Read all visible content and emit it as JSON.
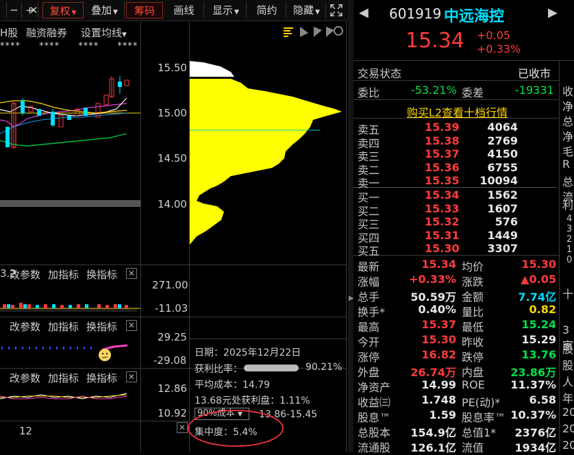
{
  "toolbar": {
    "items": [
      {
        "label": "─"
      },
      {
        "label": "+"
      },
      {
        "label": "✕"
      },
      {
        "label": "复权",
        "dropdown": true,
        "active": true
      },
      {
        "label": "叠加",
        "dropdown": true
      },
      {
        "label": "筹码",
        "active": true
      },
      {
        "label": "画线"
      },
      {
        "label": "显示",
        "dropdown": true
      },
      {
        "label": "简约"
      },
      {
        "label": "隐藏",
        "dropdown": true
      }
    ]
  },
  "subbar": {
    "items": [
      "H股",
      "融资融券",
      "设置均线"
    ]
  },
  "stars": [
    "****",
    "****",
    "****",
    "****"
  ],
  "price_axis": [
    "15.50",
    "15.00",
    "14.50",
    "14.00"
  ],
  "vol_pane": {
    "left_label": "3.2",
    "buttons": [
      "改参数",
      "加指标",
      "换指标"
    ],
    "axis": [
      "271.00",
      "-11.03"
    ]
  },
  "pane3": {
    "buttons": [
      "改参数",
      "加指标",
      "换指标"
    ],
    "axis": [
      "29.25",
      "-29.08"
    ]
  },
  "pane4": {
    "buttons": [
      "改参数",
      "加指标",
      "换指标"
    ],
    "axis": [
      "12.86",
      "10.92"
    ]
  },
  "xaxis": {
    "label": "12"
  },
  "chip_info": {
    "date": "日期：2025年12月22日",
    "profit_label": "获利比率：",
    "profit_value": "90.21%",
    "avg_cost": "平均成本：14.79",
    "profit_at": "13.68元处获利盘：1.11%",
    "cost_select": "90%成本",
    "cost_range": "13.86-15.45",
    "concentration": "集中度：5.4%"
  },
  "stock": {
    "code": "601919",
    "name": "中远海控",
    "price": "15.34",
    "change": "+0.05",
    "change_pct": "+0.33%"
  },
  "status": {
    "label": "交易状态",
    "value": "已收市"
  },
  "commission": {
    "ratio_label": "委比",
    "ratio_value": "-53.21%",
    "diff_label": "委差",
    "diff_value": "-19331"
  },
  "l2_link": "购买L2查看十档行情",
  "asks": [
    {
      "label": "卖五",
      "price": "15.39",
      "vol": "4064"
    },
    {
      "label": "卖四",
      "price": "15.38",
      "vol": "2769"
    },
    {
      "label": "卖三",
      "price": "15.37",
      "vol": "4150"
    },
    {
      "label": "卖二",
      "price": "15.36",
      "vol": "6755"
    },
    {
      "label": "卖一",
      "price": "15.35",
      "vol": "10094"
    }
  ],
  "bids": [
    {
      "label": "买一",
      "price": "15.34",
      "vol": "1562"
    },
    {
      "label": "买二",
      "price": "15.33",
      "vol": "1607"
    },
    {
      "label": "买三",
      "price": "15.32",
      "vol": "576"
    },
    {
      "label": "买四",
      "price": "15.31",
      "vol": "1449"
    },
    {
      "label": "买五",
      "price": "15.30",
      "vol": "3307"
    }
  ],
  "quotes": [
    {
      "l1": "最新",
      "v1": "15.34",
      "c1": "red",
      "l2": "均价",
      "v2": "15.30",
      "c2": "red"
    },
    {
      "l1": "涨幅",
      "v1": "+0.33%",
      "c1": "red",
      "l2": "涨跌",
      "v2": "▲0.05",
      "c2": "red"
    },
    {
      "l1": "总手",
      "v1": "50.59万",
      "c1": "white",
      "l2": "金额",
      "v2": "7.74亿",
      "c2": "cyan"
    },
    {
      "l1": "换手*",
      "v1": "0.40%",
      "c1": "white",
      "l2": "量比",
      "v2": "0.82",
      "c2": "yellow"
    },
    {
      "l1": "最高",
      "v1": "15.37",
      "c1": "red",
      "l2": "最低",
      "v2": "15.24",
      "c2": "green"
    },
    {
      "l1": "今开",
      "v1": "15.30",
      "c1": "red",
      "l2": "昨收",
      "v2": "15.29",
      "c2": "white"
    },
    {
      "l1": "涨停",
      "v1": "16.82",
      "c1": "red",
      "l2": "跌停",
      "v2": "13.76",
      "c2": "green"
    },
    {
      "l1": "外盘",
      "v1": "26.74万",
      "c1": "red",
      "l2": "内盘",
      "v2": "23.86万",
      "c2": "green"
    },
    {
      "l1": "净资产",
      "v1": "14.99",
      "c1": "white",
      "l2": "ROE",
      "v2": "11.37%",
      "c2": "white"
    },
    {
      "l1": "收益㈢",
      "v1": "1.748",
      "c1": "white",
      "l2": "PE(动)*",
      "v2": "6.58",
      "c2": "white"
    },
    {
      "l1": "股息™",
      "v1": "1.59",
      "c1": "white",
      "l2": "股息率™",
      "v2": "10.37%",
      "c2": "white"
    },
    {
      "l1": "总股本",
      "v1": "154.9亿",
      "c1": "white",
      "l2": "总值1*",
      "v2": "2376亿",
      "c2": "white"
    },
    {
      "l1": "流通股",
      "v1": "126.1亿",
      "c1": "white",
      "l2": "流值",
      "v2": "1934亿",
      "c2": "white"
    }
  ],
  "right_edge": {
    "chars_top": [
      "收",
      "净",
      "总",
      "净",
      "毛",
      "R",
      "总",
      "流"
    ],
    "tab": "利",
    "nums": [
      "4",
      "3",
      "2",
      "1",
      "0"
    ],
    "tab2": "十",
    "chars_bottom": [
      "3家",
      "股",
      "股",
      "人",
      "年",
      "20",
      "20",
      "20"
    ]
  },
  "colors": {
    "up": "#ff3b3b",
    "down": "#00e04a",
    "chip": "#ffff00",
    "accent": "#00e0ff"
  }
}
